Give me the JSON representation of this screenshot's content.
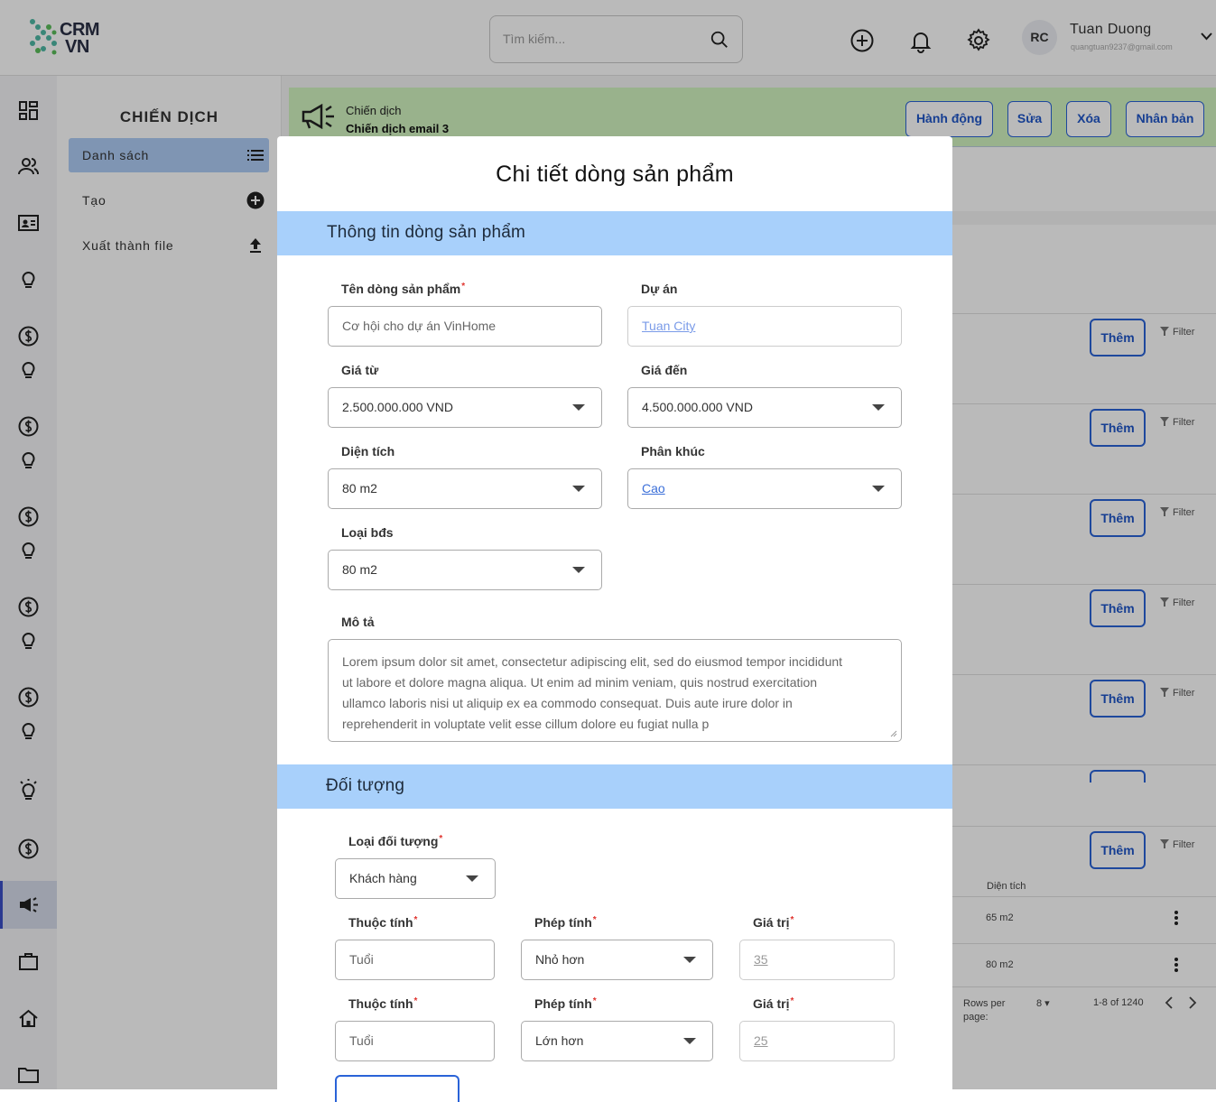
{
  "brand": {
    "line1": "CRM",
    "line2": "VN"
  },
  "search": {
    "placeholder": "Tìm kiếm..."
  },
  "user": {
    "initials": "RC",
    "name": "Tuan Duong",
    "email": "quangtuan9237@gmail.com"
  },
  "sidebar": {
    "title": "CHIẾN DỊCH",
    "items": [
      {
        "label": "Danh sách",
        "icon": "list-icon"
      },
      {
        "label": "Tạo",
        "icon": "plus-circle-icon"
      },
      {
        "label": "Xuất thành file",
        "icon": "upload-icon"
      }
    ]
  },
  "banner": {
    "label": "Chiến dịch",
    "name": "Chiến dịch email 3",
    "actions": [
      "Hành động",
      "Sửa",
      "Xóa",
      "Nhân bản"
    ]
  },
  "background_list": {
    "add_label": "Thêm",
    "filter_label": "Filter",
    "column_header": "Diện tích",
    "rows": [
      "65 m2",
      "80 m2"
    ],
    "rows_per_page_label": "Rows per page:",
    "rows_per_page": "8",
    "pagination": "1-8 of 1240"
  },
  "modal": {
    "title": "Chi tiết dòng sản phẩm",
    "section1": {
      "title": "Thông tin dòng sản phẩm",
      "name_label": "Tên dòng sản phẩm",
      "name_placeholder": "Cơ hội cho dự án VinHome",
      "project_label": "Dự án",
      "project_value": "Tuan City",
      "price_from_label": "Giá từ",
      "price_from": "2.500.000.000 VND",
      "price_to_label": "Giá đến",
      "price_to": "4.500.000.000 VND",
      "area_label": "Diện tích",
      "area": "80 m2",
      "segment_label": "Phân khúc",
      "segment": "Cao",
      "type_label": "Loại bđs",
      "type": "80 m2",
      "desc_label": "Mô tả",
      "desc": "Lorem ipsum dolor sit amet, consectetur adipiscing elit, sed do eiusmod tempor incididunt ut labore et dolore magna aliqua. Ut enim ad minim veniam, quis nostrud exercitation ullamco laboris nisi ut aliquip ex ea commodo consequat. Duis aute irure dolor in reprehenderit in voluptate velit esse cillum dolore eu fugiat nulla p"
    },
    "section2": {
      "title": "Đối tượng",
      "target_type_label": "Loại đối tượng",
      "target_type": "Khách hàng",
      "conditions": [
        {
          "attr_label": "Thuộc tính",
          "attr_placeholder": "Tuổi",
          "op_label": "Phép tính",
          "op": "Nhỏ hơn",
          "val_label": "Giá trị",
          "val": "35"
        },
        {
          "attr_label": "Thuộc tính",
          "attr_placeholder": "Tuổi",
          "op_label": "Phép tính",
          "op": "Lớn hơn",
          "val_label": "Giá trị",
          "val": "25"
        }
      ]
    }
  },
  "colors": {
    "accent": "#2a63d8",
    "section_bg": "#a8d0fb",
    "banner_bg": "#d2f5c0",
    "required": "#e0342f"
  }
}
